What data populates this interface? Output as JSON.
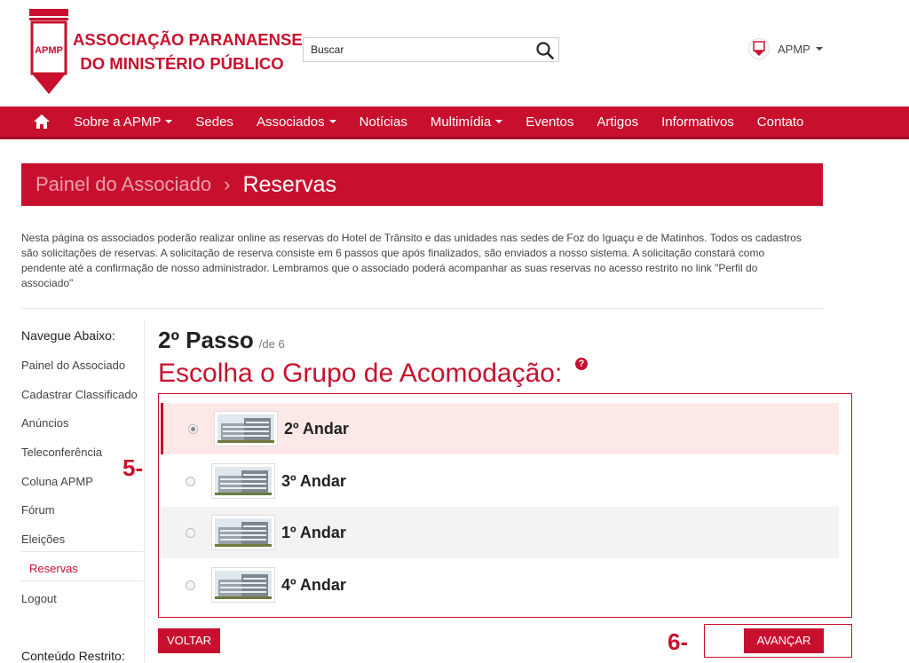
{
  "header": {
    "logo_line1": "ASSOCIAÇÃO PARANAENSE",
    "logo_line2": "DO MINISTÉRIO PÚBLICO",
    "logo_mark": "APMP",
    "search_placeholder": "Buscar",
    "user_label": "APMP"
  },
  "nav": {
    "items": [
      {
        "label": "Sobre a APMP",
        "dropdown": true
      },
      {
        "label": "Sedes",
        "dropdown": false
      },
      {
        "label": "Associados",
        "dropdown": true
      },
      {
        "label": "Notícias",
        "dropdown": false
      },
      {
        "label": "Multimídia",
        "dropdown": true
      },
      {
        "label": "Eventos",
        "dropdown": false
      },
      {
        "label": "Artigos",
        "dropdown": false
      },
      {
        "label": "Informativos",
        "dropdown": false
      },
      {
        "label": "Contato",
        "dropdown": false
      }
    ]
  },
  "breadcrumb": {
    "parent": "Painel do Associado",
    "separator": "›",
    "current": "Reservas"
  },
  "intro": "Nesta página os associados poderão realizar online as reservas do Hotel de Trânsito e das unidades nas sedes de Foz do Iguaçu e de Matinhos. Todos os cadastros são solicitações de reservas. A solicitação de reserva consiste em 6 passos que após finalizados, são enviados a nosso sistema. A solicitação constará como pendente até a confirmação de nosso administrador. Lembramos que o associado poderá acompanhar as suas reservas no acesso restrito no link \"Perfil do associado\"",
  "sidebar": {
    "heading": "Navegue Abaixo:",
    "items": [
      {
        "label": "Painel do Associado"
      },
      {
        "label": "Cadastrar Classificado"
      },
      {
        "label": "Anúncios"
      },
      {
        "label": "Teleconferência"
      },
      {
        "label": "Coluna APMP"
      },
      {
        "label": "Fórum"
      },
      {
        "label": "Eleições"
      },
      {
        "label": "Reservas"
      },
      {
        "label": "Logout"
      }
    ],
    "restricted_heading": "Conteúdo Restrito:"
  },
  "step": {
    "title": "2º Passo",
    "of": "/de 6",
    "group_title": "Escolha o Grupo de Acomodação:",
    "help_glyph": "?"
  },
  "options": [
    {
      "label": "2º Andar",
      "selected": true
    },
    {
      "label": "3º Andar",
      "selected": false
    },
    {
      "label": "1º Andar",
      "selected": false
    },
    {
      "label": "4º Andar",
      "selected": false
    }
  ],
  "annotations": {
    "a5": "5-",
    "a6": "6-"
  },
  "buttons": {
    "back": "VOLTAR",
    "next": "AVANÇAR"
  },
  "colors": {
    "brand": "#c8102e",
    "selected_bg": "#fde8e8",
    "alt_row_bg": "#f3f3f3"
  },
  "icons": {
    "search": "search-icon",
    "home": "home-icon",
    "help": "help-icon",
    "user": "user-avatar-icon"
  }
}
